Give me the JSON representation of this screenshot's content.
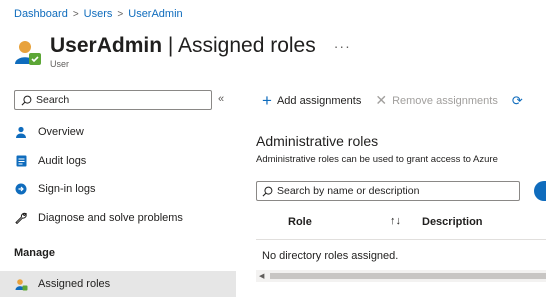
{
  "breadcrumb": {
    "items": [
      "Dashboard",
      "Users",
      "UserAdmin"
    ],
    "separator": ">"
  },
  "header": {
    "title_name": "UserAdmin",
    "title_rest": " | Assigned roles",
    "more": "···",
    "subtitle": "User"
  },
  "nav": {
    "search_placeholder": "Search",
    "collapse": "«",
    "items": [
      {
        "label": "Overview",
        "icon": "person-icon"
      },
      {
        "label": "Audit logs",
        "icon": "audit-log-icon"
      },
      {
        "label": "Sign-in logs",
        "icon": "sign-in-logs-icon"
      },
      {
        "label": "Diagnose and solve problems",
        "icon": "wrench-icon"
      }
    ],
    "section": "Manage",
    "active_item": {
      "label": "Assigned roles",
      "icon": "assigned-roles-icon"
    }
  },
  "toolbar": {
    "add_label": "Add assignments",
    "remove_label": "Remove assignments"
  },
  "content": {
    "section_title": "Administrative roles",
    "section_desc": "Administrative roles can be used to grant access to Azure",
    "search_placeholder": "Search by name or description",
    "columns": [
      "Role",
      "Description"
    ],
    "sort_glyph": "↑↓",
    "empty_message": "No directory roles assigned."
  },
  "colors": {
    "accent": "#0f6cbd",
    "active_bg": "#e6e6e6"
  }
}
